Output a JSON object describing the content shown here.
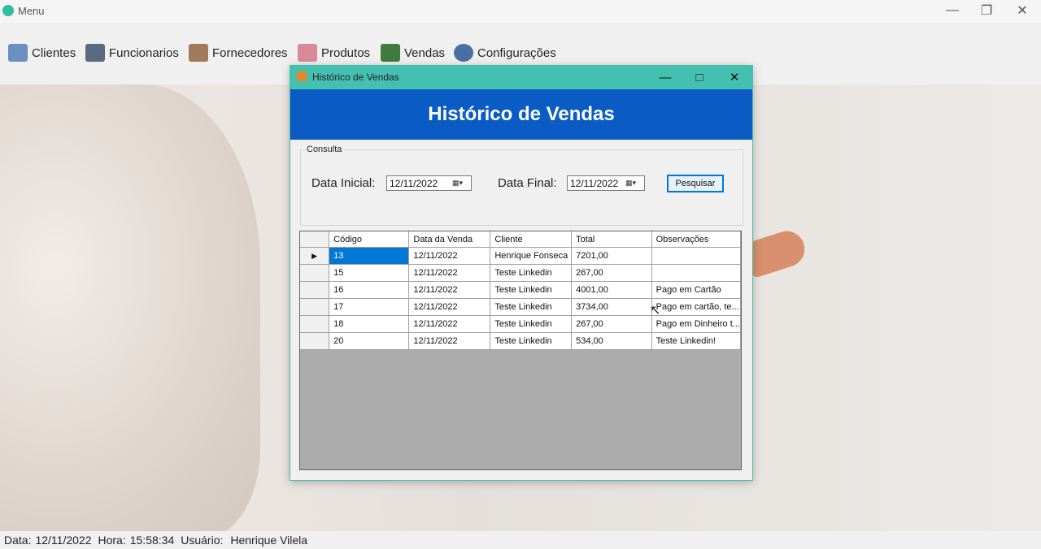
{
  "app": {
    "title": "Menu",
    "window_controls": [
      "minimize",
      "maximize",
      "close"
    ]
  },
  "menubar": {
    "items": [
      {
        "label": "Clientes",
        "icon": "clients-icon"
      },
      {
        "label": "Funcionarios",
        "icon": "employees-icon"
      },
      {
        "label": "Fornecedores",
        "icon": "suppliers-icon"
      },
      {
        "label": "Produtos",
        "icon": "products-icon"
      },
      {
        "label": "Vendas",
        "icon": "sales-icon"
      },
      {
        "label": "Configurações",
        "icon": "settings-gear-icon"
      }
    ]
  },
  "dialog": {
    "title": "Histórico de Vendas",
    "banner": "Histórico de Vendas",
    "consulta": {
      "legend": "Consulta",
      "data_inicial_label": "Data Inicial:",
      "data_inicial_value": "12/11/2022",
      "data_final_label": "Data Final:",
      "data_final_value": "12/11/2022",
      "pesquisar_label": "Pesquisar"
    },
    "grid": {
      "columns": [
        "Código",
        "Data da Venda",
        "Cliente",
        "Total",
        "Observações"
      ],
      "rows": [
        [
          "13",
          "12/11/2022",
          "Henrique Fonseca",
          "7201,00",
          ""
        ],
        [
          "15",
          "12/11/2022",
          "Teste Linkedin",
          "267,00",
          ""
        ],
        [
          "16",
          "12/11/2022",
          "Teste Linkedin",
          "4001,00",
          "Pago em Cartão"
        ],
        [
          "17",
          "12/11/2022",
          "Teste Linkedin",
          "3734,00",
          "Pago em cartão, te..."
        ],
        [
          "18",
          "12/11/2022",
          "Teste Linkedin",
          "267,00",
          "Pago em Dinheiro t..."
        ],
        [
          "20",
          "12/11/2022",
          "Teste Linkedin",
          "534,00",
          "Teste Linkedin!"
        ]
      ],
      "current_row_marker": "▶"
    }
  },
  "statusbar": {
    "data_label": "Data:",
    "data_value": "12/11/2022",
    "hora_label": "Hora:",
    "hora_value": "15:58:34",
    "usuario_label": "Usuário:",
    "usuario_value": "Henrique Vilela"
  },
  "colors": {
    "accent_teal": "#44c0b0",
    "banner_blue": "#0a5cc4",
    "selection_blue": "#0078d7"
  }
}
